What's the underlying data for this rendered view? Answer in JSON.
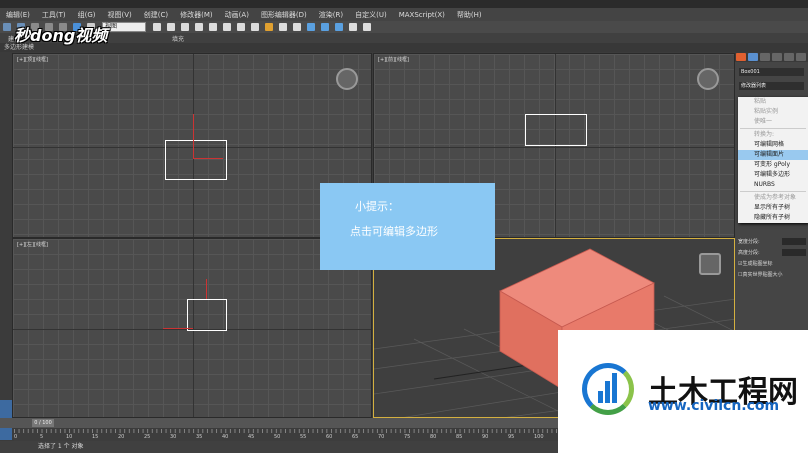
{
  "logo": {
    "text": "秒dong视频"
  },
  "menu": {
    "items": [
      "编辑(E)",
      "工具(T)",
      "组(G)",
      "视图(V)",
      "创建(C)",
      "修改器(M)",
      "动画(A)",
      "图形编辑器(D)",
      "渲染(R)",
      "自定义(U)",
      "MAXScript(X)",
      "帮助(H)"
    ]
  },
  "toolbar": {
    "selection_filter": "视图"
  },
  "ribbon": {
    "tab_modeling": "建模",
    "tab_fill": "填充",
    "sub_label": "多边形建模"
  },
  "viewports": {
    "top": "[+][顶][线框]",
    "front": "[+][前][线框]",
    "left": "[+][左][线框]"
  },
  "hint": {
    "title": "小提示：",
    "body": "点击可编辑多边形"
  },
  "command_panel": {
    "object_name": "Box001",
    "modifier_list": "修改器列表"
  },
  "context_menu": {
    "items": [
      {
        "label": "粘贴",
        "disabled": true
      },
      {
        "label": "粘贴实例",
        "disabled": true
      },
      {
        "label": "使唯一",
        "disabled": true
      },
      {
        "label": "转换为:",
        "disabled": true
      },
      {
        "label": "可编辑网格",
        "disabled": false
      },
      {
        "label": "可编辑面片",
        "disabled": false,
        "highlighted": true
      },
      {
        "label": "可变形 gPoly",
        "disabled": false
      },
      {
        "label": "可编辑多边形",
        "disabled": false
      },
      {
        "label": "NURBS",
        "disabled": false
      },
      {
        "label": "使成为参考对象",
        "disabled": true
      },
      {
        "label": "显示所有子树",
        "disabled": false
      },
      {
        "label": "隐藏所有子树",
        "disabled": false
      }
    ]
  },
  "params": {
    "width_label": "宽度分段:",
    "height_label": "高度分段:",
    "gen_mapping": "生成贴图坐标",
    "real_world": "真实世界贴图大小"
  },
  "timeline": {
    "frame": "0 / 100"
  },
  "ruler": {
    "ticks": [
      "0",
      "5",
      "10",
      "15",
      "20",
      "25",
      "30",
      "35",
      "40",
      "45",
      "50",
      "55",
      "60",
      "65",
      "70",
      "75",
      "80",
      "85",
      "90",
      "95",
      "100"
    ]
  },
  "status": {
    "text": "选择了 1 个 对象"
  },
  "watermark": {
    "title": "土木工程网",
    "url": "www.civilcn.com"
  },
  "colors": {
    "hint_bg": "#8ac8f3",
    "box_3d": "#e8786a",
    "highlight": "#99c9ef"
  }
}
